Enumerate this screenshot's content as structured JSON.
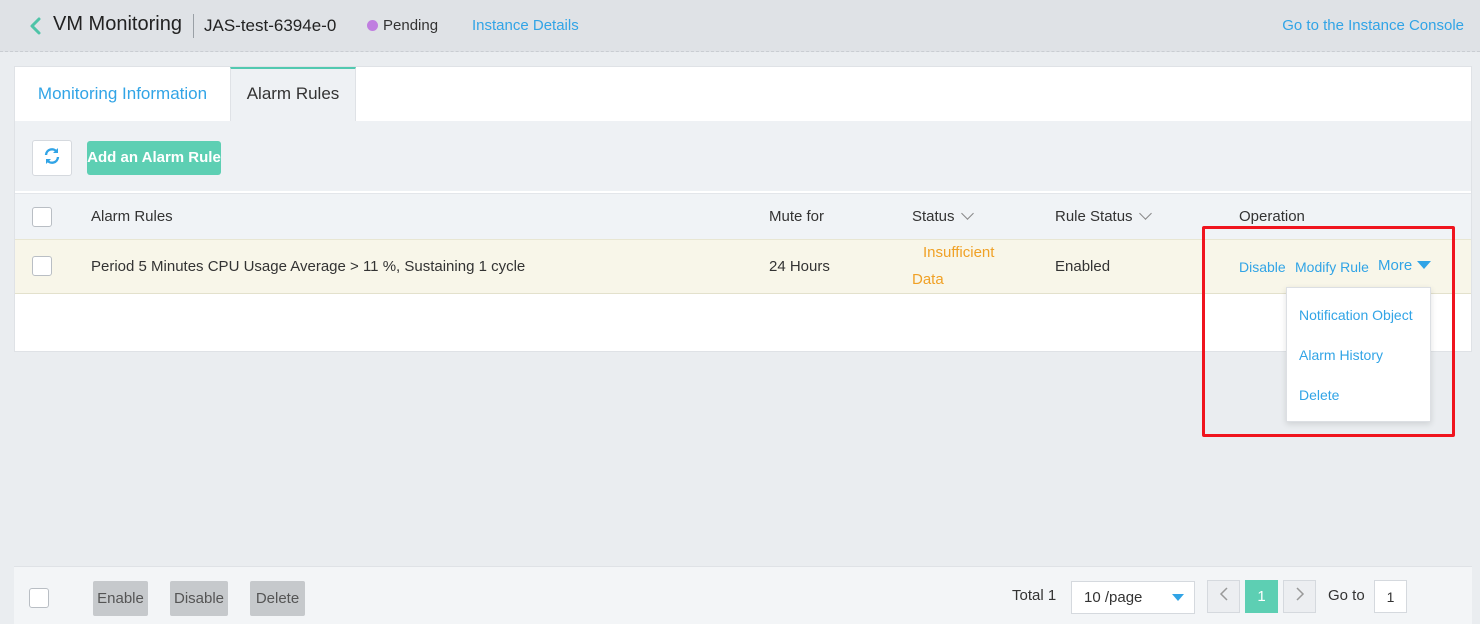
{
  "header": {
    "title": "VM Monitoring",
    "instance": "JAS-test-6394e-0",
    "status": "Pending",
    "instance_details": "Instance Details",
    "go_console": "Go to the Instance Console"
  },
  "tabs": [
    {
      "label": "Monitoring Information",
      "active": false
    },
    {
      "label": "Alarm Rules",
      "active": true
    }
  ],
  "toolbar": {
    "refresh_icon": "refresh-icon",
    "add_label": "Add an Alarm Rule"
  },
  "table": {
    "headers": {
      "rules": "Alarm Rules",
      "mute": "Mute for",
      "status": "Status",
      "rule_status": "Rule Status",
      "operation": "Operation"
    },
    "rows": [
      {
        "rule": "Period 5 Minutes CPU Usage Average > 11 %, Sustaining 1 cycle",
        "mute": "24 Hours",
        "status_line1": "Insufficient",
        "status_line2": "Data",
        "rule_status": "Enabled",
        "op_disable": "Disable",
        "op_modify": "Modify Rule",
        "op_more": "More"
      }
    ]
  },
  "dropdown": {
    "items": [
      "Notification Object",
      "Alarm History",
      "Delete"
    ]
  },
  "footer": {
    "enable": "Enable",
    "disable": "Disable",
    "delete": "Delete",
    "total": "Total 1",
    "page_size": "10 /page",
    "current_page": "1",
    "goto_label": "Go to",
    "goto_value": "1"
  },
  "colors": {
    "accent_link": "#31a4e6",
    "primary_button": "#5dcfb3",
    "status_warning": "#f0a126",
    "status_pending_dot": "#c07ee0",
    "highlight_box": "#f0141e"
  }
}
